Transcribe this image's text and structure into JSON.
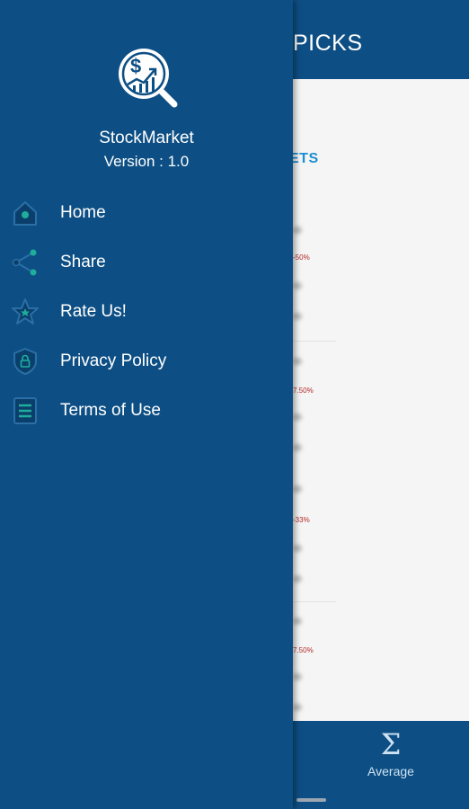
{
  "background_app": {
    "title": "PICKS",
    "section_heading": "ETS",
    "cards": [
      {
        "change": "-50%"
      },
      {
        "change": "7.50%"
      },
      {
        "change": "-33%"
      },
      {
        "change": "7.50%"
      }
    ],
    "bottom_nav": {
      "label": "Average",
      "icon": "sigma-icon",
      "glyph": "Σ"
    }
  },
  "drawer": {
    "app_name": "StockMarket",
    "version": "Version : 1.0",
    "logo_icon": "stock-magnifier-logo",
    "items": [
      {
        "label": "Home",
        "icon": "home-icon"
      },
      {
        "label": "Share",
        "icon": "share-icon"
      },
      {
        "label": "Rate Us!",
        "icon": "star-icon"
      },
      {
        "label": "Privacy Policy",
        "icon": "shield-lock-icon"
      },
      {
        "label": "Terms of Use",
        "icon": "document-list-icon"
      }
    ]
  },
  "colors": {
    "primary": "#0d4f84",
    "accent_teal": "#1fae9b",
    "link_blue": "#1b8fd2",
    "negative_red": "#b52a2a",
    "background": "#f5f5f5"
  }
}
